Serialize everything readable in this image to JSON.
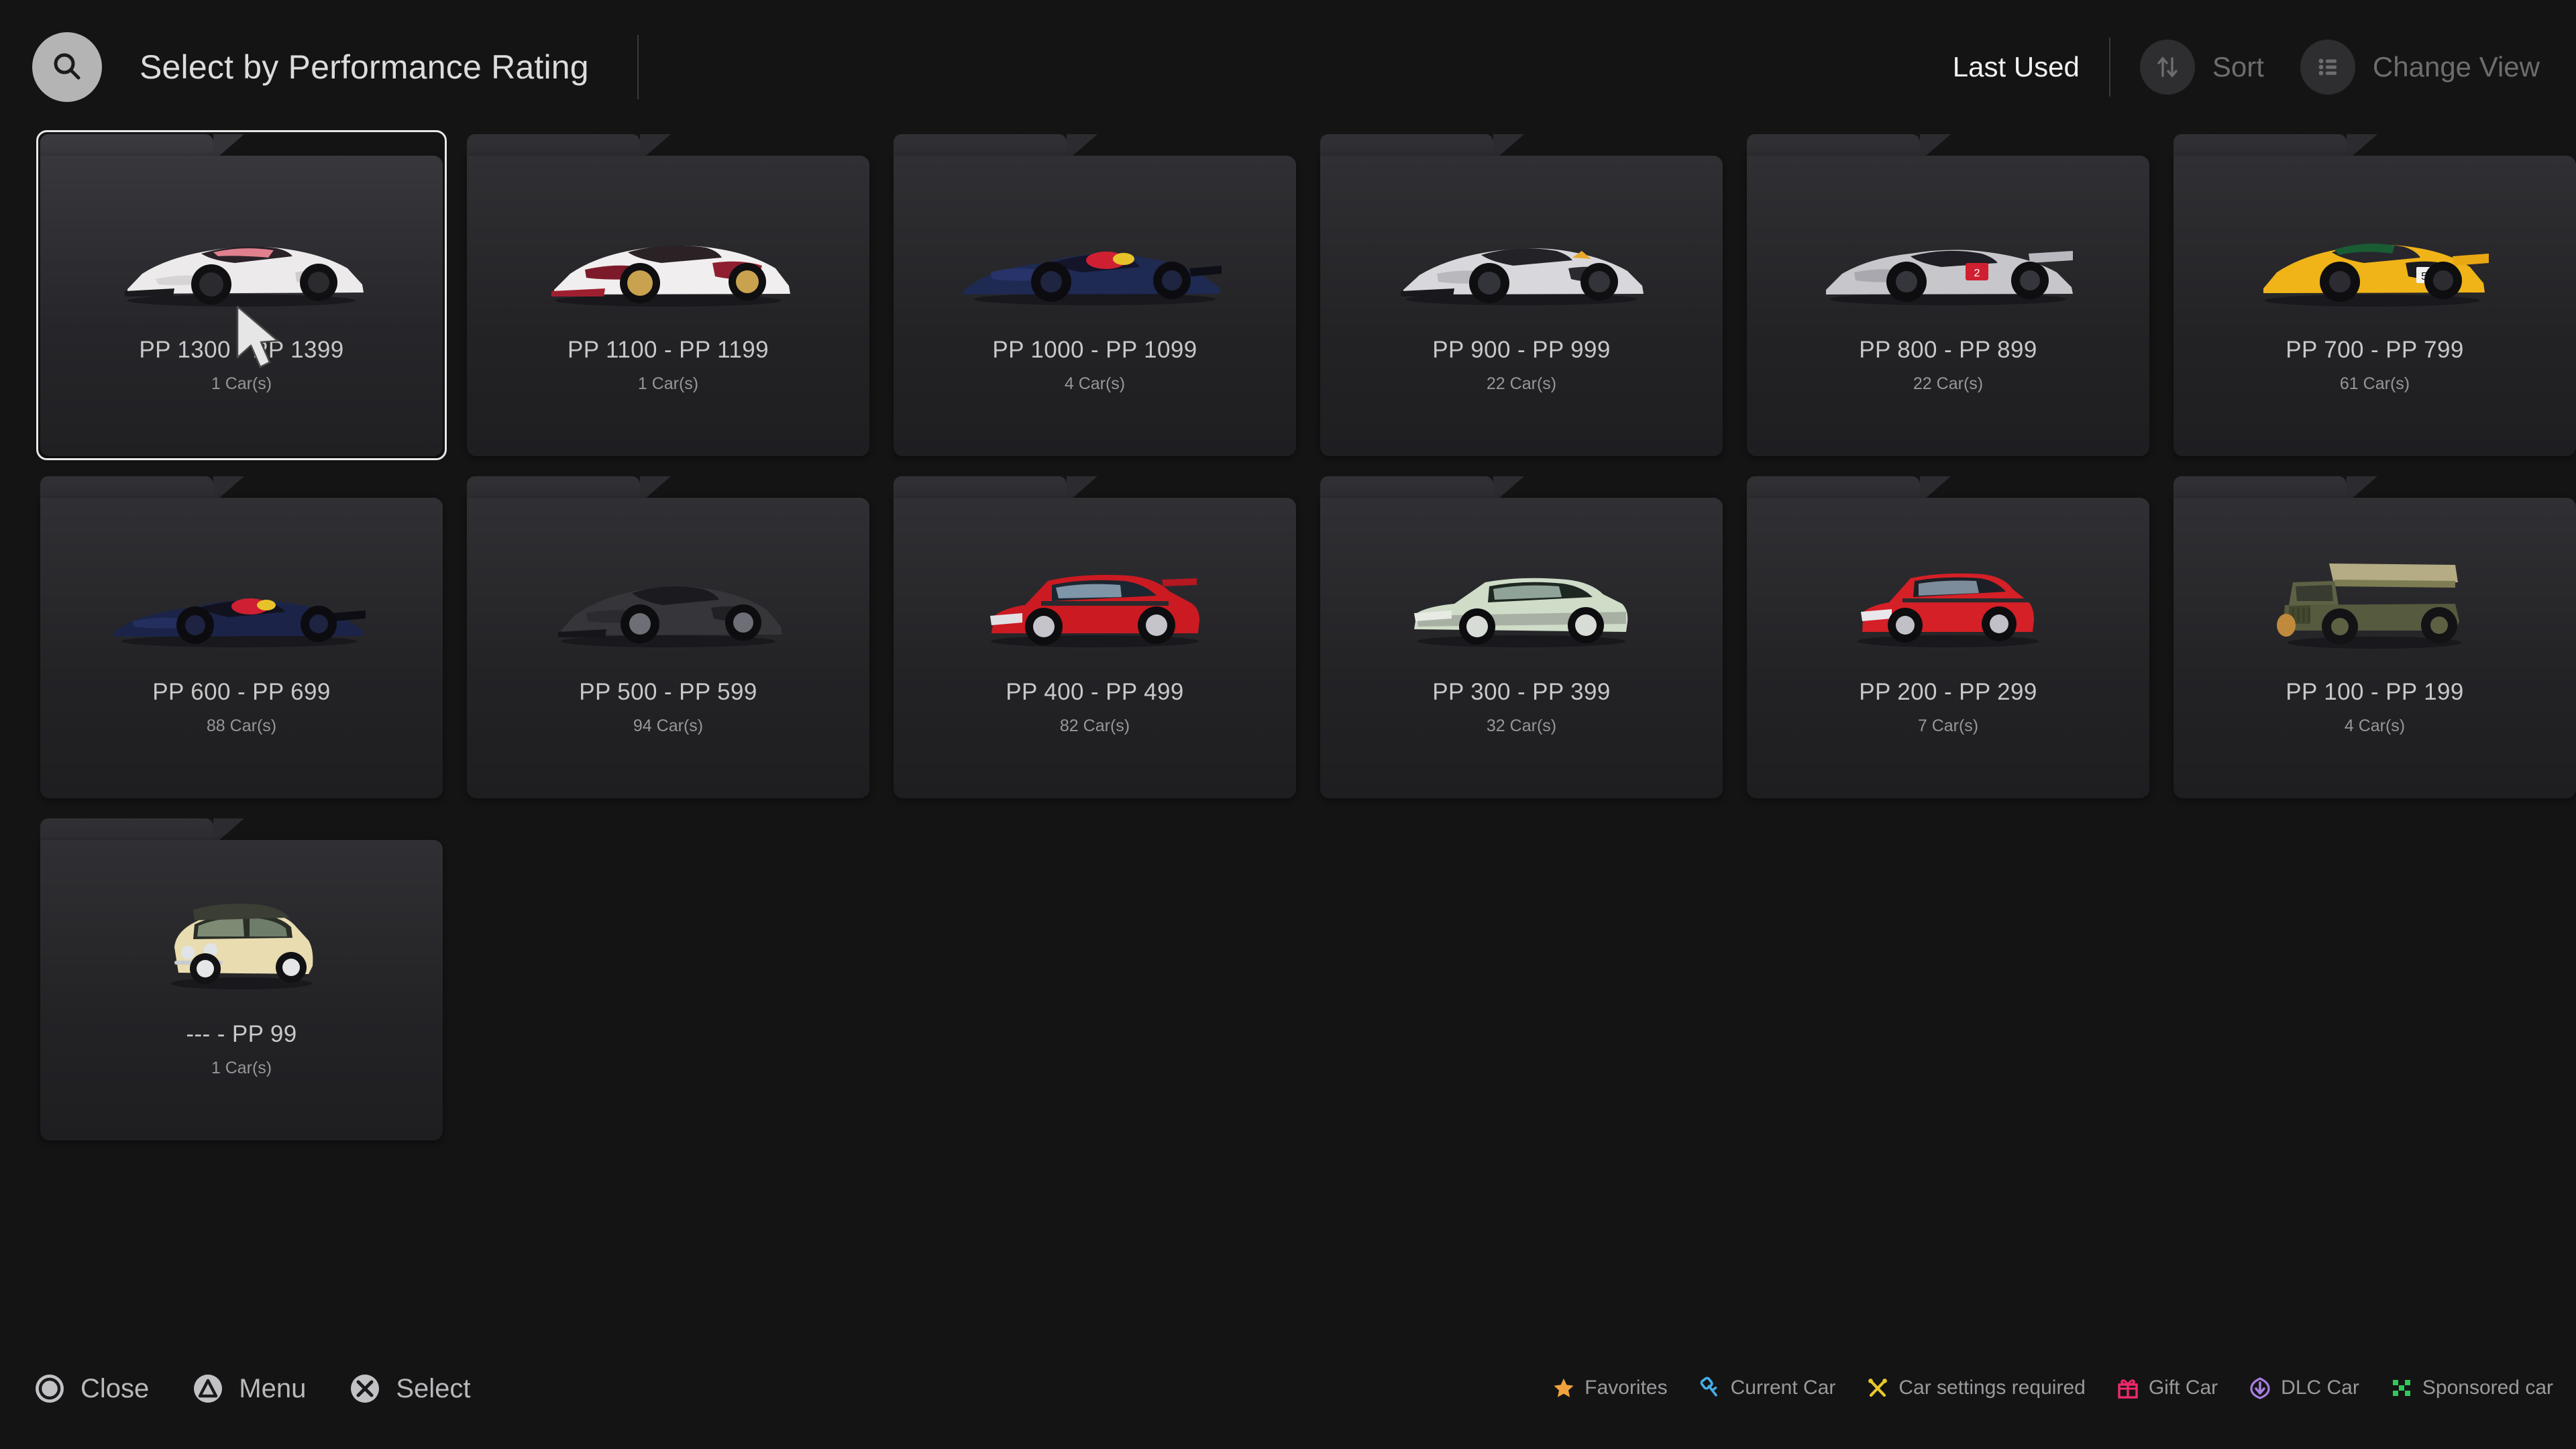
{
  "header": {
    "search_icon": "search-icon",
    "title": "Select by Performance Rating",
    "sort_value": "Last Used",
    "sort_label": "Sort",
    "sort_icon": "sort-arrows-icon",
    "change_view_label": "Change View",
    "change_view_icon": "list-view-icon"
  },
  "cards": [
    {
      "title": "PP 1300 - PP 1399",
      "count": "1 Car(s)",
      "selected": true,
      "car": "white-srt-tomahawk"
    },
    {
      "title": "PP 1100 - PP 1199",
      "count": "1 Car(s)",
      "selected": false,
      "car": "white-red-srt-racer"
    },
    {
      "title": "PP 1000 - PP 1099",
      "count": "4 Car(s)",
      "selected": false,
      "car": "blue-redbull-x2014"
    },
    {
      "title": "PP 900 - PP 999",
      "count": "22 Car(s)",
      "selected": false,
      "car": "silver-vgt-prototype"
    },
    {
      "title": "PP 800 - PP 899",
      "count": "22 Car(s)",
      "selected": false,
      "car": "silver-audi-lmp"
    },
    {
      "title": "PP 700 - PP 799",
      "count": "61 Car(s)",
      "selected": false,
      "car": "yellow-mclaren-p1-gtr"
    },
    {
      "title": "PP 600 - PP 699",
      "count": "88 Car(s)",
      "selected": false,
      "car": "blue-redbull-x2010"
    },
    {
      "title": "PP 500 - PP 599",
      "count": "94 Car(s)",
      "selected": false,
      "car": "black-sports-coupe"
    },
    {
      "title": "PP 400 - PP 499",
      "count": "82 Car(s)",
      "selected": false,
      "car": "red-lancer-evo"
    },
    {
      "title": "PP 300 - PP 399",
      "count": "32 Car(s)",
      "selected": false,
      "car": "pale-green-silvia"
    },
    {
      "title": "PP 200 - PP 299",
      "count": "7 Car(s)",
      "selected": false,
      "car": "red-golf-hatchback"
    },
    {
      "title": "PP 100 - PP 199",
      "count": "4 Car(s)",
      "selected": false,
      "car": "olive-willys-jeep"
    },
    {
      "title": "--- - PP 99",
      "count": "1 Car(s)",
      "selected": false,
      "car": "cream-fiat-500"
    }
  ],
  "footer": {
    "buttons": [
      {
        "icon": "ps-circle-icon",
        "label": "Close"
      },
      {
        "icon": "ps-triangle-icon",
        "label": "Menu"
      },
      {
        "icon": "ps-cross-icon",
        "label": "Select"
      }
    ],
    "legend": [
      {
        "icon": "star-icon",
        "label": "Favorites",
        "color": "#f0a33c"
      },
      {
        "icon": "key-icon",
        "label": "Current Car",
        "color": "#47aee8"
      },
      {
        "icon": "wrench-icon",
        "label": "Car settings required",
        "color": "#e8c92a"
      },
      {
        "icon": "gift-icon",
        "label": "Gift Car",
        "color": "#f0296b"
      },
      {
        "icon": "download-icon",
        "label": "DLC Car",
        "color": "#a87ee0"
      },
      {
        "icon": "checker-icon",
        "label": "Sponsored car",
        "color": "#2fc95a"
      }
    ]
  }
}
